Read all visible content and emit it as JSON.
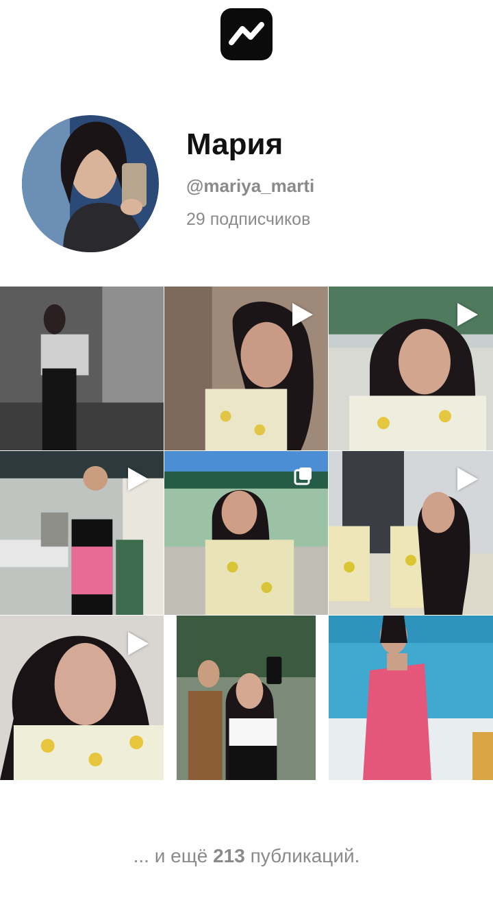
{
  "app": {
    "logo_icon": "trend-line-icon",
    "logo_bg": "#0b0b0b"
  },
  "profile": {
    "name": "Мария",
    "handle": "@mariya_marti",
    "followers": "29 подписчиков"
  },
  "posts": [
    {
      "badge": "none"
    },
    {
      "badge": "play-icon"
    },
    {
      "badge": "play-icon"
    },
    {
      "badge": "play-icon"
    },
    {
      "badge": "carousel-icon"
    },
    {
      "badge": "play-icon"
    },
    {
      "badge": "play-icon"
    },
    {
      "badge": "none"
    },
    {
      "badge": "none"
    }
  ],
  "footer": {
    "prefix": "... и ещё",
    "count": "213",
    "suffix": "публикаций."
  },
  "colors": {
    "muted_text": "#8a8a8a",
    "title_text": "#111111"
  }
}
